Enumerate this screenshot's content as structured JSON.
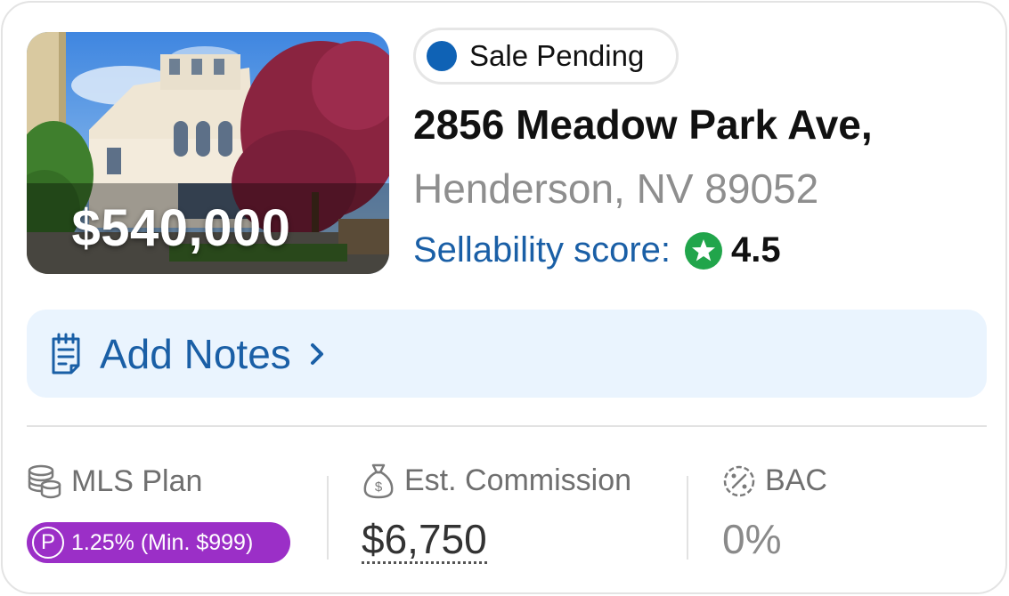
{
  "listing": {
    "price": "$540,000",
    "status": "Sale Pending",
    "address_line1": "2856 Meadow Park Ave,",
    "address_line2": "Henderson, NV 89052",
    "sellability_label": "Sellability score:",
    "sellability_score": "4.5"
  },
  "notes": {
    "label": "Add Notes"
  },
  "stats": {
    "mls_plan_label": "MLS Plan",
    "mls_plan_badge_icon": "P",
    "mls_plan_value": "1.25% (Min. $999)",
    "commission_label": "Est. Commission",
    "commission_value": "$6,750",
    "bac_label": "BAC",
    "bac_value": "0%"
  },
  "colors": {
    "accent": "#1a5fa6",
    "status_dot": "#0f62b5",
    "plan_badge": "#9b2fc7",
    "score_star": "#21a54b",
    "notes_bg": "#eaf4fe"
  },
  "icons": {
    "status": "status-dot-icon",
    "score": "star-badge-icon",
    "notes": "notepad-icon",
    "chevron": "chevron-right-icon",
    "mls": "coins-stack-icon",
    "commission": "money-bag-icon",
    "bac": "percent-badge-icon"
  }
}
